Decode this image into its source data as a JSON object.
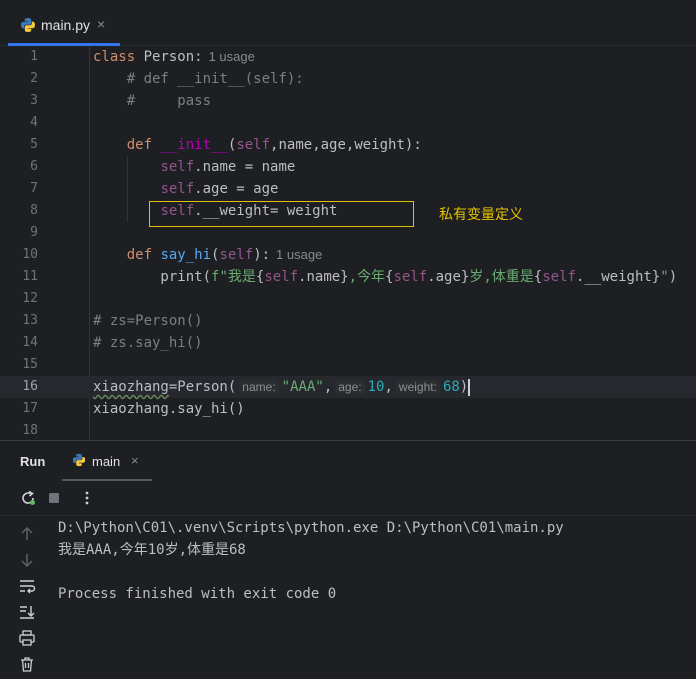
{
  "editor_tab": {
    "label": "main.py",
    "close": "×"
  },
  "code_lines": [
    {
      "n": "1",
      "usage": "1 usage"
    },
    {
      "n": "2"
    },
    {
      "n": "3"
    },
    {
      "n": "4"
    },
    {
      "n": "5"
    },
    {
      "n": "6"
    },
    {
      "n": "7"
    },
    {
      "n": "8"
    },
    {
      "n": "9"
    },
    {
      "n": "10",
      "usage": "1 usage"
    },
    {
      "n": "11"
    },
    {
      "n": "12"
    },
    {
      "n": "13"
    },
    {
      "n": "14"
    },
    {
      "n": "15"
    },
    {
      "n": "16"
    },
    {
      "n": "17"
    },
    {
      "n": "18"
    }
  ],
  "inlay_hints": {
    "name": "name:",
    "age": "age:",
    "weight": "weight:"
  },
  "annotation": "私有变量定义",
  "run_panel": {
    "title": "Run",
    "tab_label": "main",
    "tab_close": "×"
  },
  "console": {
    "lines": [
      "D:\\Python\\C01\\.venv\\Scripts\\python.exe D:\\Python\\C01\\main.py",
      "我是AAA,今年10岁,体重是68",
      "",
      "Process finished with exit code 0"
    ]
  },
  "colors": {
    "accent": "#3574f0",
    "annotation": "#e4c100",
    "keyword": "#cf8e6d",
    "function": "#56a8f5",
    "dunder": "#b200b2",
    "self": "#94558d",
    "comment": "#7a7e85",
    "string": "#6aab73",
    "number": "#2aacb8"
  },
  "icons": [
    "python-file-icon",
    "rerun-icon",
    "stop-icon",
    "more-options-icon",
    "up-arrow-icon",
    "down-arrow-icon",
    "soft-wrap-icon",
    "scroll-to-end-icon",
    "print-icon",
    "trash-icon"
  ]
}
